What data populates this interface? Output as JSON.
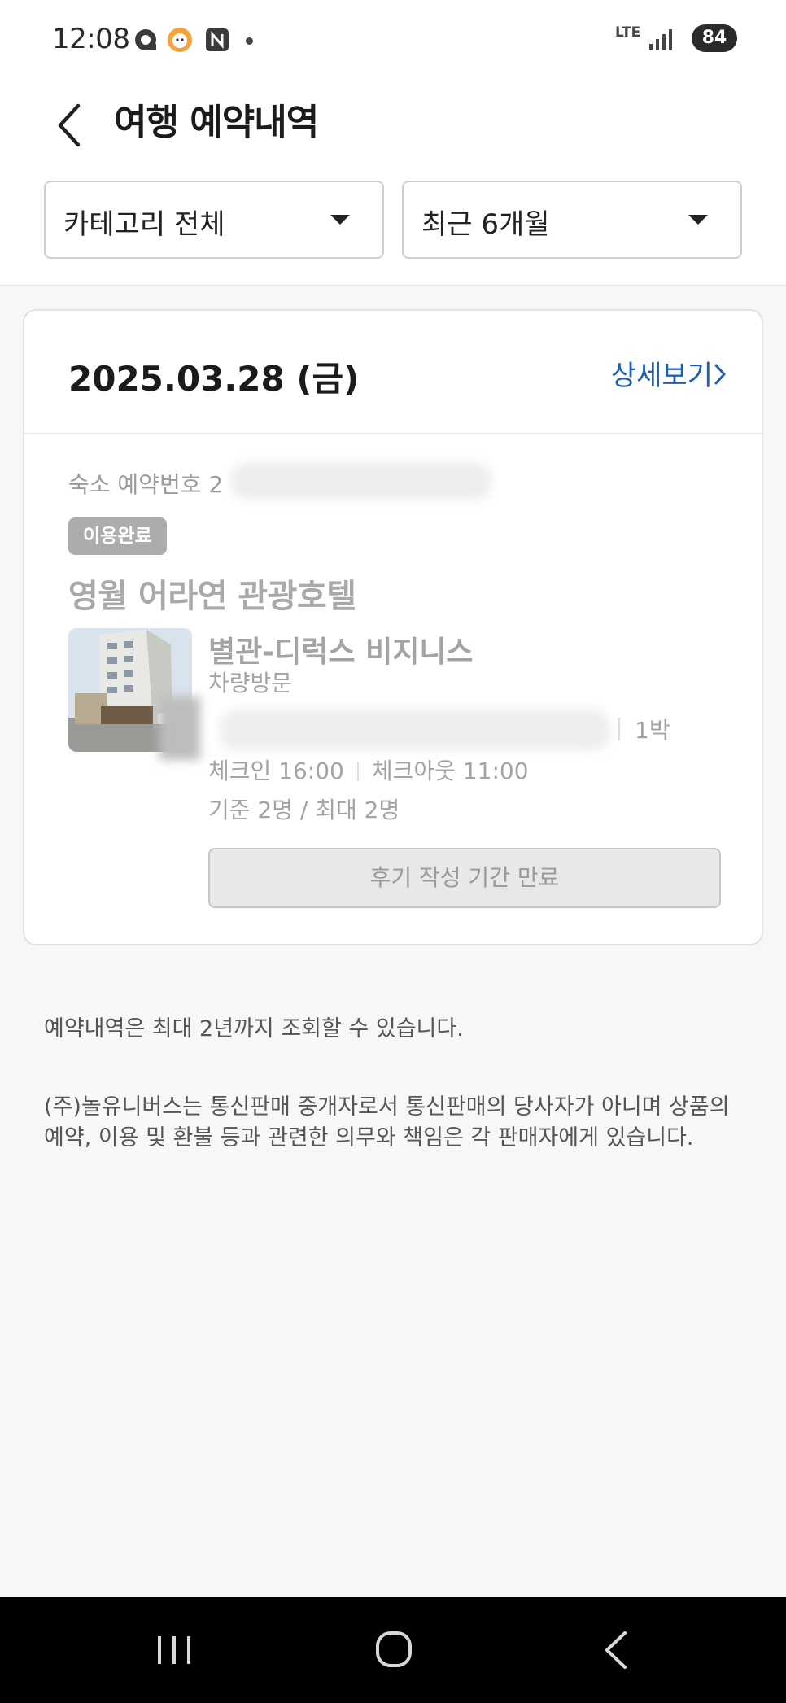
{
  "status_bar": {
    "time": "12:08",
    "network": "LTE",
    "battery": "84",
    "notification_icons": [
      "chat-bubble-icon",
      "emoji-app-icon",
      "n-app-icon",
      "dot-icon"
    ]
  },
  "header": {
    "title": "여행 예약내역",
    "filters": {
      "category": "카테고리 전체",
      "period": "최근 6개월"
    }
  },
  "reservation": {
    "date": "2025.03.28 (금)",
    "detail_link": "상세보기",
    "number_label": "숙소 예약번호 2",
    "status": "이용완료",
    "hotel_name": "영월 어라연 관광호텔",
    "room_name": "별관-디럭스 비지니스",
    "visit_type": "차량방문",
    "nights": "1박",
    "check_in": "체크인 16:00",
    "check_out": "체크아웃 11:00",
    "occupancy": "기준 2명 / 최대 2명",
    "review_button": "후기 작성 기간 만료"
  },
  "notices": {
    "period_notice": "예약내역은 최대 2년까지 조회할 수 있습니다.",
    "liability_notice": "(주)놀유니버스는 통신판매 중개자로서 통신판매의 당사자가 아니며 상품의 예약, 이용 및 환불 등과 관련한 의무와 책임은 각 판매자에게 있습니다."
  },
  "colors": {
    "accent": "#1f5fae",
    "badge": "#acacac",
    "muted_text": "#a3a3a3"
  }
}
